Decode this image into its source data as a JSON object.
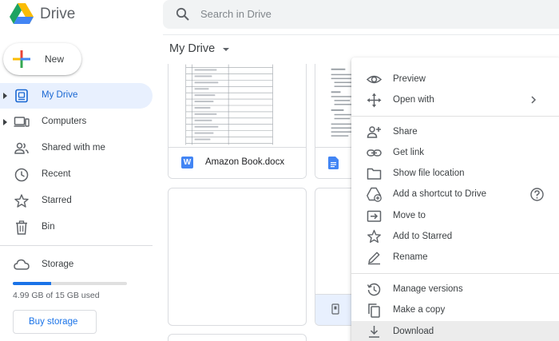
{
  "header": {
    "app_name": "Drive",
    "logo_icon": "google-drive-logo",
    "search_placeholder": "Search in Drive"
  },
  "sidebar": {
    "new_button_label": "New",
    "items": [
      {
        "label": "My Drive",
        "icon": "my-drive-icon",
        "active": true,
        "expandable": true
      },
      {
        "label": "Computers",
        "icon": "computers-icon",
        "active": false,
        "expandable": true
      },
      {
        "label": "Shared with me",
        "icon": "shared-with-me-icon",
        "active": false,
        "expandable": false
      },
      {
        "label": "Recent",
        "icon": "clock-icon",
        "active": false,
        "expandable": false
      },
      {
        "label": "Starred",
        "icon": "star-icon",
        "active": false,
        "expandable": false
      },
      {
        "label": "Bin",
        "icon": "trash-icon",
        "active": false,
        "expandable": false
      }
    ],
    "storage": {
      "label": "Storage",
      "icon": "cloud-icon",
      "used_text": "4.99 GB of 15 GB used",
      "used_fraction": 0.333
    },
    "buy_storage_label": "Buy storage"
  },
  "main": {
    "title": "My Drive",
    "files": [
      {
        "name": "Amazon Book.docx",
        "type_icon": "word-icon",
        "type_letter": "W"
      },
      {
        "name": "",
        "type_icon": "google-docs-icon"
      },
      {
        "name": "",
        "type_icon": ""
      },
      {
        "name": "",
        "type_icon": "file-icon"
      }
    ]
  },
  "context_menu": {
    "items": [
      {
        "label": "Preview",
        "icon": "eye-icon"
      },
      {
        "label": "Open with",
        "icon": "move-arrows-icon",
        "submenu": true
      },
      {
        "label": "Share",
        "icon": "add-person-icon"
      },
      {
        "label": "Get link",
        "icon": "link-icon"
      },
      {
        "label": "Show file location",
        "icon": "folder-icon"
      },
      {
        "label": "Add a shortcut to Drive",
        "icon": "drive-shortcut-icon",
        "help": true
      },
      {
        "label": "Move to",
        "icon": "move-to-folder-icon"
      },
      {
        "label": "Add to Starred",
        "icon": "star-outline-icon"
      },
      {
        "label": "Rename",
        "icon": "pencil-icon"
      },
      {
        "label": "Manage versions",
        "icon": "history-icon"
      },
      {
        "label": "Make a copy",
        "icon": "copy-icon"
      },
      {
        "label": "Download",
        "icon": "download-icon",
        "highlighted": true
      }
    ]
  },
  "colors": {
    "accent": "#1a73e8",
    "active_nav_bg": "#e8f0fe",
    "active_nav_text": "#1967d2",
    "menu_hover_bg": "#ececec"
  }
}
